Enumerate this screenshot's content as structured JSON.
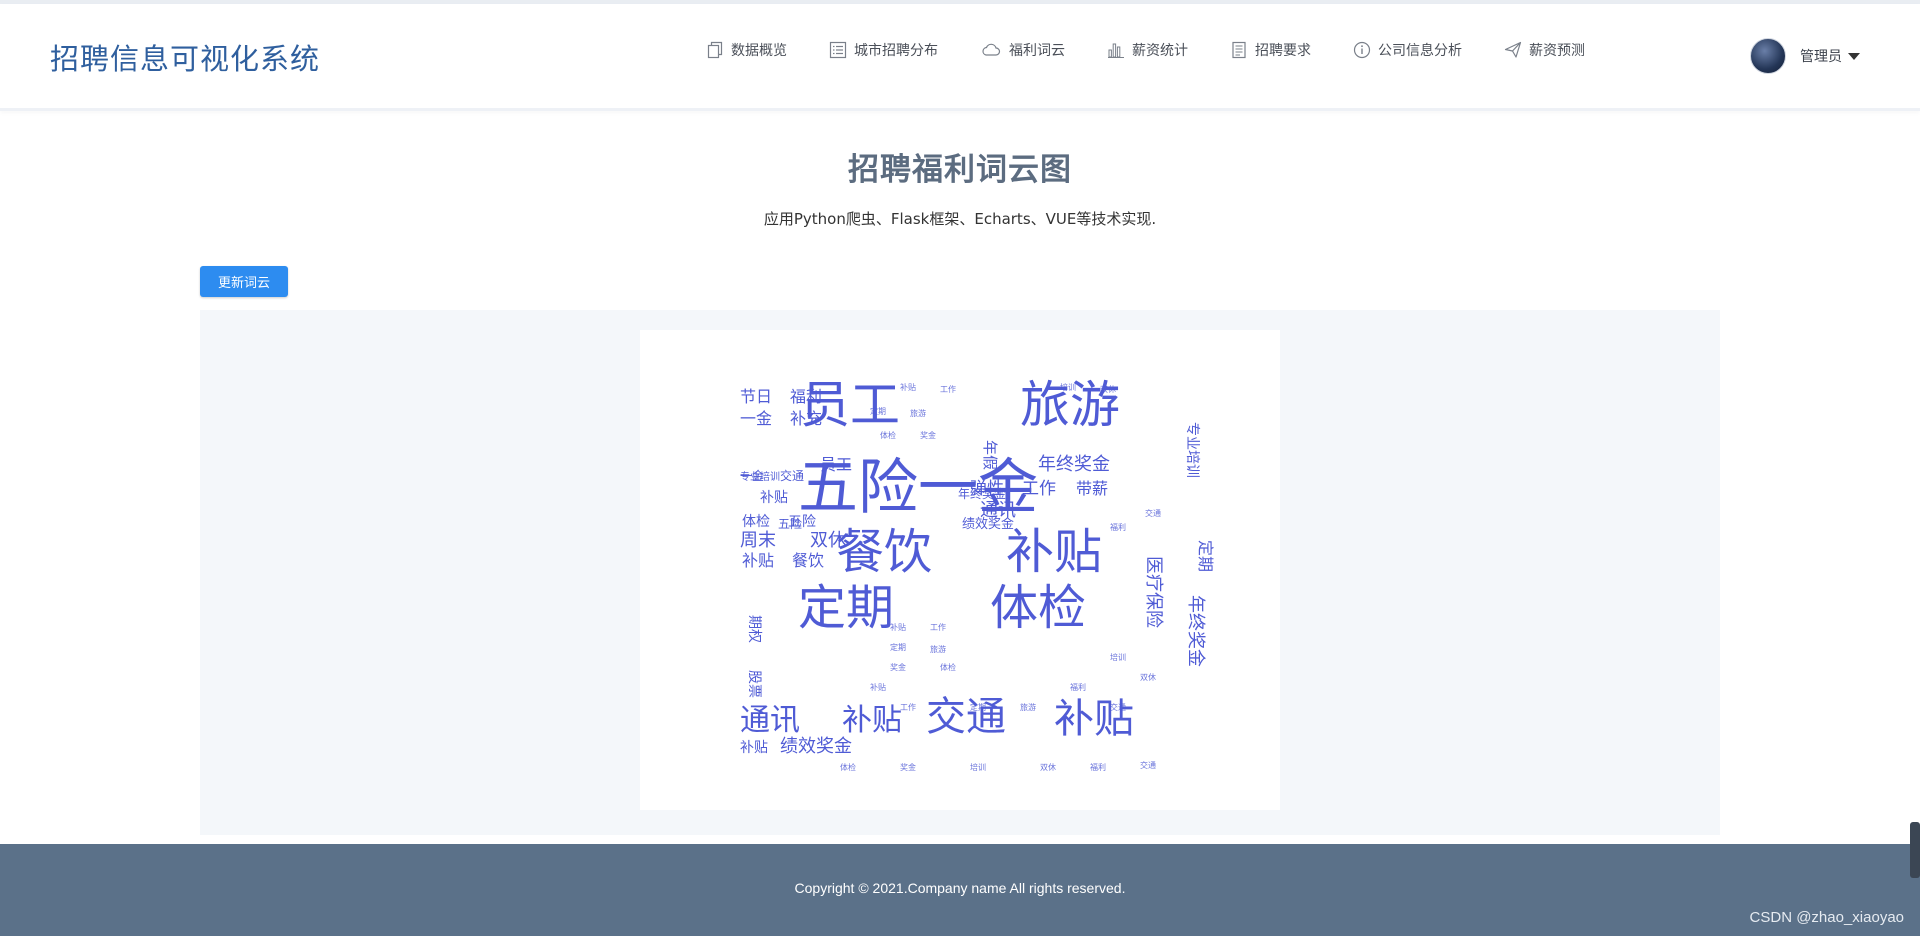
{
  "app": {
    "title": "招聘信息可视化系统"
  },
  "nav": {
    "items": [
      {
        "label": "数据概览",
        "icon": "copy-icon"
      },
      {
        "label": "城市招聘分布",
        "icon": "list-icon"
      },
      {
        "label": "福利词云",
        "icon": "cloud-icon"
      },
      {
        "label": "薪资统计",
        "icon": "bar-chart-icon"
      },
      {
        "label": "招聘要求",
        "icon": "document-icon"
      },
      {
        "label": "公司信息分析",
        "icon": "info-icon"
      },
      {
        "label": "薪资预测",
        "icon": "paper-plane-icon"
      }
    ]
  },
  "user": {
    "name": "管理员"
  },
  "main": {
    "title": "招聘福利词云图",
    "subtitle": "应用Python爬虫、Flask框架、Echarts、VUE等技术实现.",
    "refresh_label": "更新词云"
  },
  "wordcloud": {
    "color": "#4f5bd5",
    "words": [
      {
        "text": "五险一金",
        "size": 60
      },
      {
        "text": "员工",
        "size": 50
      },
      {
        "text": "旅游",
        "size": 50
      },
      {
        "text": "餐饮",
        "size": 48
      },
      {
        "text": "补贴",
        "size": 48
      },
      {
        "text": "定期",
        "size": 48
      },
      {
        "text": "体检",
        "size": 48
      },
      {
        "text": "交通",
        "size": 40
      },
      {
        "text": "补贴",
        "size": 40
      },
      {
        "text": "通讯",
        "size": 30
      },
      {
        "text": "补贴",
        "size": 30
      },
      {
        "text": "绩效奖金",
        "size": 18
      },
      {
        "text": "年终奖金",
        "size": 18
      },
      {
        "text": "弹性",
        "size": 17
      },
      {
        "text": "工作",
        "size": 17
      },
      {
        "text": "带薪",
        "size": 16
      },
      {
        "text": "年假",
        "size": 15
      },
      {
        "text": "节日",
        "size": 16
      },
      {
        "text": "福利",
        "size": 16
      },
      {
        "text": "一金",
        "size": 16
      },
      {
        "text": "补充",
        "size": 16
      },
      {
        "text": "员工",
        "size": 16
      },
      {
        "text": "周末",
        "size": 18
      },
      {
        "text": "双休",
        "size": 18
      },
      {
        "text": "补贴",
        "size": 16
      },
      {
        "text": "餐饮",
        "size": 16
      },
      {
        "text": "体检",
        "size": 14
      },
      {
        "text": "五险",
        "size": 14
      },
      {
        "text": "补贴",
        "size": 14
      },
      {
        "text": "通讯",
        "size": 18
      },
      {
        "text": "补贴",
        "size": 14
      },
      {
        "text": "绩效奖金",
        "size": 13
      },
      {
        "text": "医疗保险",
        "size": 18
      },
      {
        "text": "年终奖金",
        "size": 18
      },
      {
        "text": "定期",
        "size": 16
      },
      {
        "text": "专业培训",
        "size": 14
      },
      {
        "text": "股票",
        "size": 14
      },
      {
        "text": "期权",
        "size": 14
      },
      {
        "text": "一金",
        "size": 12
      },
      {
        "text": "交通",
        "size": 12
      },
      {
        "text": "专业培训",
        "size": 10
      },
      {
        "text": "年终奖金",
        "size": 12
      },
      {
        "text": "五险",
        "size": 12
      }
    ]
  },
  "footer": {
    "copyright": "Copyright © 2021.Company name All rights reserved.",
    "watermark": "CSDN @zhao_xiaoyao"
  }
}
